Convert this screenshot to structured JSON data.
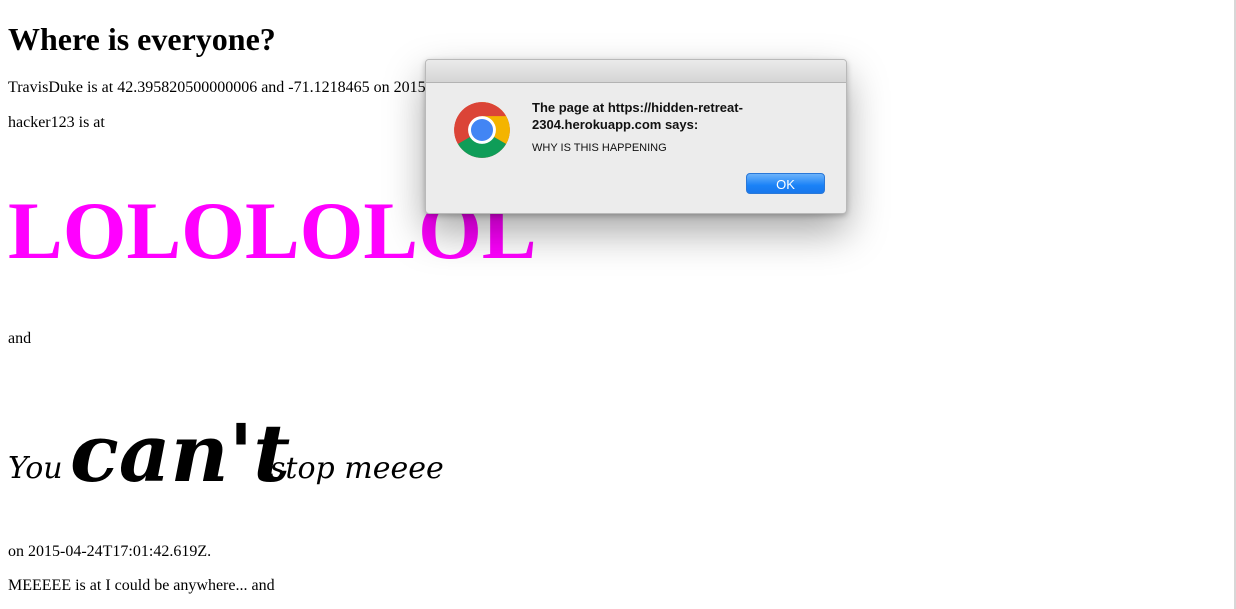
{
  "page": {
    "heading": "Where is everyone?",
    "entries": {
      "line1": "TravisDuke is at 42.395820500000006 and -71.1218465 on 2015",
      "line2": "hacker123 is at",
      "lol": "LOLOLOLOL",
      "line3": "and",
      "cursive_you": "You",
      "cursive_cant": "can't",
      "cursive_stop": "stop meeee",
      "line4": "on 2015-04-24T17:01:42.619Z.",
      "line5": "MEEEEE is at I could be anywhere... and"
    },
    "colors": {
      "lol": "#ff00ff"
    }
  },
  "dialog": {
    "icon": "chrome-icon",
    "title": "The page at https://hidden-retreat-2304.herokuapp.com says:",
    "message": "WHY IS THIS HAPPENING",
    "ok_label": "OK",
    "colors": {
      "ok_button": "#1a82f7"
    }
  }
}
